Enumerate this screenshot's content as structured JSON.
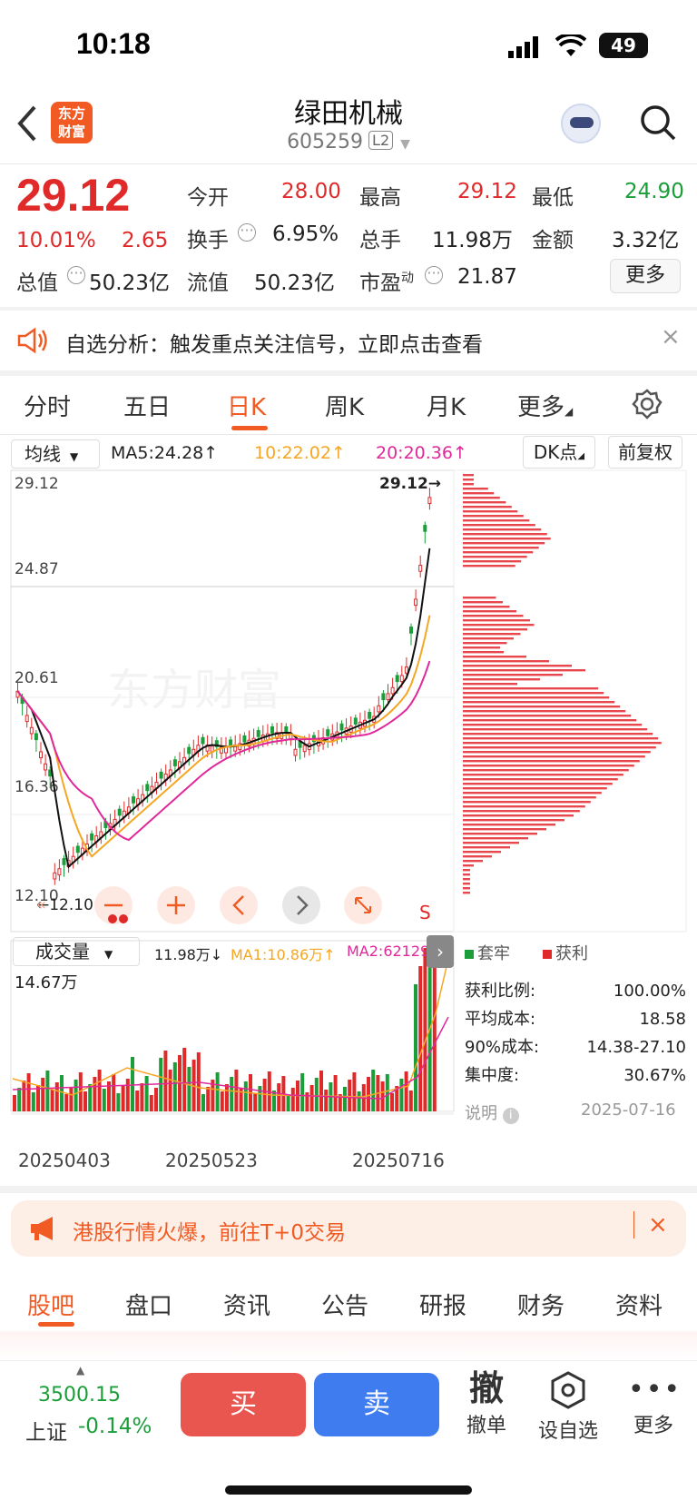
{
  "status": {
    "time": "10:18",
    "battery": "49"
  },
  "header": {
    "name": "绿田机械",
    "code": "605259",
    "level": "L2",
    "logo_top": "东方",
    "logo_bottom": "财富"
  },
  "quote": {
    "price": "29.12",
    "pct": "10.01%",
    "chg": "2.65",
    "open_l": "今开",
    "open": "28.00",
    "high_l": "最高",
    "high": "29.12",
    "low_l": "最低",
    "low": "24.90",
    "turn_l": "换手",
    "turn": "6.95%",
    "vol_l": "总手",
    "vol": "11.98万",
    "amt_l": "金额",
    "amt": "3.32亿",
    "mcap_l": "总值",
    "mcap": "50.23亿",
    "fcap_l": "流值",
    "fcap": "50.23亿",
    "pe_l": "市盈",
    "pe_sup": "动",
    "pe": "21.87",
    "more": "更多"
  },
  "alert": {
    "text": "自选分析：触发重点关注信号，立即点击查看"
  },
  "tabs": [
    "分时",
    "五日",
    "日K",
    "周K",
    "月K",
    "更多"
  ],
  "kline": {
    "indicator": "均线",
    "ma5": "MA5:24.28↑",
    "ma10": "10:22.02↑",
    "ma20": "20:20.36↑",
    "dk": "DK点",
    "adj": "前复权",
    "y_labels": [
      "29.12",
      "24.87",
      "20.61",
      "16.36",
      "12.10"
    ],
    "max_mark": "29.12→",
    "min_mark": "←12.10",
    "s_mark": "S",
    "watermark": "东方财富"
  },
  "volume": {
    "indicator": "成交量",
    "vol": "11.98万↓",
    "ma1": "MA1:10.86万↑",
    "ma2": "MA2:62129",
    "max": "14.67万",
    "dates": [
      "20250403",
      "20250523",
      "20250716"
    ]
  },
  "chips": {
    "legend_trap": "套牢",
    "legend_profit": "获利",
    "rows": [
      {
        "k": "获利比例:",
        "v": "100.00%"
      },
      {
        "k": "平均成本:",
        "v": "18.58"
      },
      {
        "k": "90%成本:",
        "v": "14.38-27.10"
      },
      {
        "k": "集中度:",
        "v": "30.67%"
      }
    ],
    "note": "说明",
    "date": "2025-07-16"
  },
  "ad": {
    "text": "港股行情火爆，前往T+0交易"
  },
  "bottom_tabs": [
    "股吧",
    "盘口",
    "资讯",
    "公告",
    "研报",
    "财务",
    "资料"
  ],
  "footer": {
    "index_val": "3500.15",
    "index_name": "上证",
    "index_pct": "-0.14%",
    "buy": "买",
    "sell": "卖",
    "cancel_icon": "撤",
    "cancel": "撤单",
    "watch": "设自选",
    "more": "更多"
  }
}
